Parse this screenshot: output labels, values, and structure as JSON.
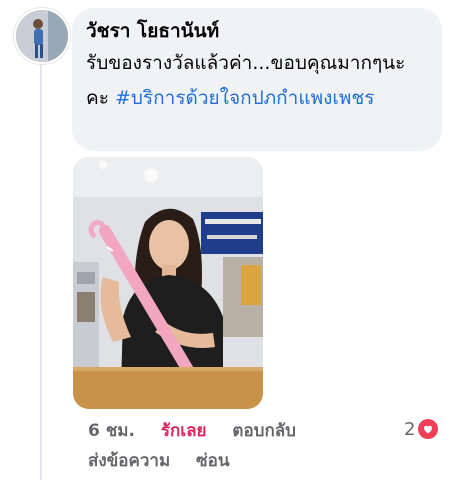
{
  "comment": {
    "author": "วัชรา โยธานันท์",
    "text": "รับของรางวัลแล้วค่า...ขอบคุณมากๆนะคะ ",
    "hashtag": "#บริการด้วยใจกปภกำแพงเพชร"
  },
  "meta": {
    "time": "6 ชม.",
    "like_label": "รักเลย",
    "reply_label": "ตอบกลับ",
    "message_label": "ส่งข้อความ",
    "hide_label": "ซ่อน",
    "reaction_count": "2"
  },
  "icons": {
    "reaction": "heart-icon"
  },
  "colors": {
    "hashtag": "#216fdb",
    "like_active": "#e0245e",
    "heart_badge": "#f33e58"
  }
}
